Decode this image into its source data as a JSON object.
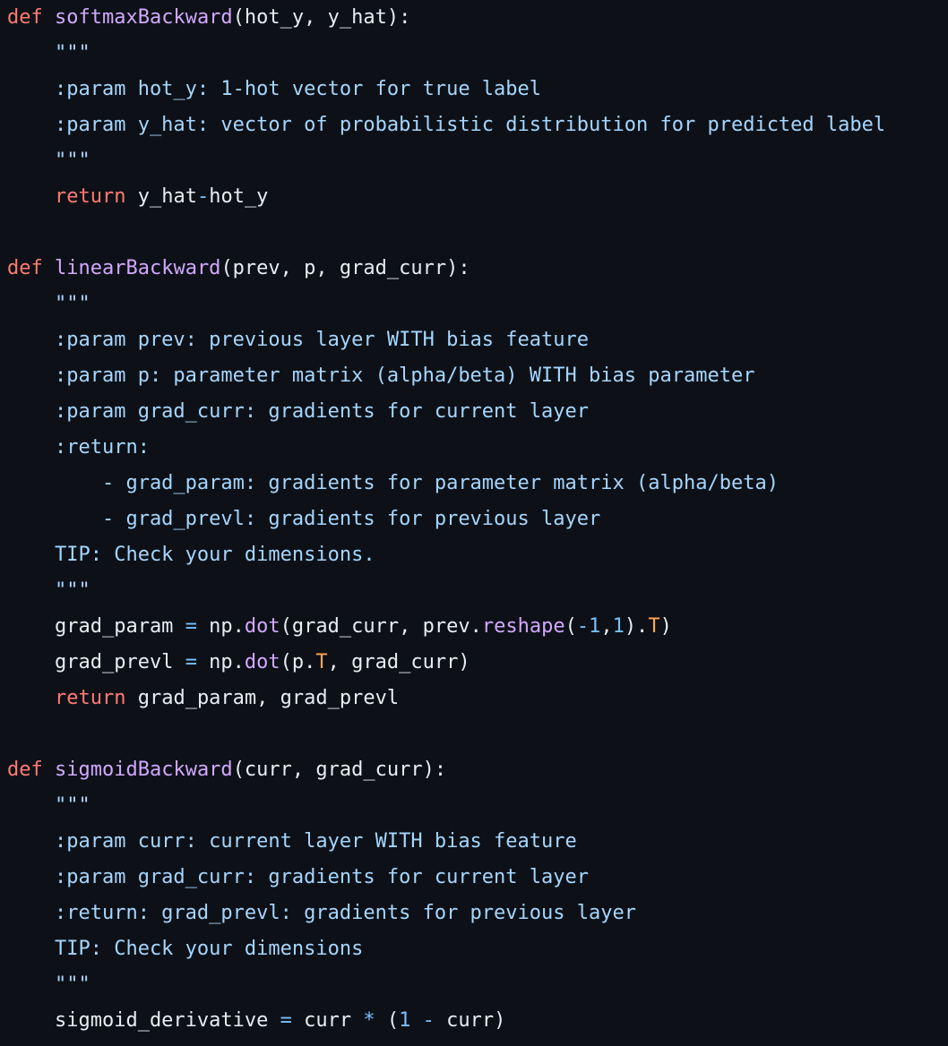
{
  "code_lines": [
    [
      {
        "t": "def",
        "c": "kw"
      },
      {
        "t": " ",
        "c": "plain"
      },
      {
        "t": "softmaxBackward",
        "c": "fn"
      },
      {
        "t": "(hot_y, y_hat):",
        "c": "plain"
      }
    ],
    [
      {
        "t": "    \"\"\"",
        "c": "doc"
      }
    ],
    [
      {
        "t": "    :param hot_y: 1-hot vector for true label",
        "c": "doc"
      }
    ],
    [
      {
        "t": "    :param y_hat: vector of probabilistic distribution for predicted label",
        "c": "doc"
      }
    ],
    [
      {
        "t": "    \"\"\"",
        "c": "doc"
      }
    ],
    [
      {
        "t": "    ",
        "c": "plain"
      },
      {
        "t": "return",
        "c": "kw"
      },
      {
        "t": " y_hat",
        "c": "plain"
      },
      {
        "t": "-",
        "c": "op"
      },
      {
        "t": "hot_y",
        "c": "plain"
      }
    ],
    [],
    [
      {
        "t": "def",
        "c": "kw"
      },
      {
        "t": " ",
        "c": "plain"
      },
      {
        "t": "linearBackward",
        "c": "fn"
      },
      {
        "t": "(prev, p, grad_curr):",
        "c": "plain"
      }
    ],
    [
      {
        "t": "    \"\"\"",
        "c": "doc"
      }
    ],
    [
      {
        "t": "    :param prev: previous layer WITH bias feature",
        "c": "doc"
      }
    ],
    [
      {
        "t": "    :param p: parameter matrix (alpha/beta) WITH bias parameter",
        "c": "doc"
      }
    ],
    [
      {
        "t": "    :param grad_curr: gradients for current layer",
        "c": "doc"
      }
    ],
    [
      {
        "t": "    :return:",
        "c": "doc"
      }
    ],
    [
      {
        "t": "        - grad_param: gradients for parameter matrix (alpha/beta)",
        "c": "doc"
      }
    ],
    [
      {
        "t": "        - grad_prevl: gradients for previous layer",
        "c": "doc"
      }
    ],
    [
      {
        "t": "    TIP: Check your dimensions.",
        "c": "doc"
      }
    ],
    [
      {
        "t": "    \"\"\"",
        "c": "doc"
      }
    ],
    [
      {
        "t": "    grad_param ",
        "c": "plain"
      },
      {
        "t": "=",
        "c": "op"
      },
      {
        "t": " np.",
        "c": "plain"
      },
      {
        "t": "dot",
        "c": "meth"
      },
      {
        "t": "(grad_curr, prev.",
        "c": "plain"
      },
      {
        "t": "reshape",
        "c": "meth"
      },
      {
        "t": "(",
        "c": "plain"
      },
      {
        "t": "-1",
        "c": "num"
      },
      {
        "t": ",",
        "c": "plain"
      },
      {
        "t": "1",
        "c": "num"
      },
      {
        "t": ").",
        "c": "plain"
      },
      {
        "t": "T",
        "c": "const"
      },
      {
        "t": ")",
        "c": "plain"
      }
    ],
    [
      {
        "t": "    grad_prevl ",
        "c": "plain"
      },
      {
        "t": "=",
        "c": "op"
      },
      {
        "t": " np.",
        "c": "plain"
      },
      {
        "t": "dot",
        "c": "meth"
      },
      {
        "t": "(p.",
        "c": "plain"
      },
      {
        "t": "T",
        "c": "const"
      },
      {
        "t": ", grad_curr)",
        "c": "plain"
      }
    ],
    [
      {
        "t": "    ",
        "c": "plain"
      },
      {
        "t": "return",
        "c": "kw"
      },
      {
        "t": " grad_param, grad_prevl",
        "c": "plain"
      }
    ],
    [],
    [
      {
        "t": "def",
        "c": "kw"
      },
      {
        "t": " ",
        "c": "plain"
      },
      {
        "t": "sigmoidBackward",
        "c": "fn"
      },
      {
        "t": "(curr, grad_curr):",
        "c": "plain"
      }
    ],
    [
      {
        "t": "    \"\"\"",
        "c": "doc"
      }
    ],
    [
      {
        "t": "    :param curr: current layer WITH bias feature",
        "c": "doc"
      }
    ],
    [
      {
        "t": "    :param grad_curr: gradients for current layer",
        "c": "doc"
      }
    ],
    [
      {
        "t": "    :return: grad_prevl: gradients for previous layer",
        "c": "doc"
      }
    ],
    [
      {
        "t": "    TIP: Check your dimensions",
        "c": "doc"
      }
    ],
    [
      {
        "t": "    \"\"\"",
        "c": "doc"
      }
    ],
    [
      {
        "t": "    sigmoid_derivative ",
        "c": "plain"
      },
      {
        "t": "=",
        "c": "op"
      },
      {
        "t": " curr ",
        "c": "plain"
      },
      {
        "t": "*",
        "c": "op"
      },
      {
        "t": " (",
        "c": "plain"
      },
      {
        "t": "1",
        "c": "num"
      },
      {
        "t": " ",
        "c": "plain"
      },
      {
        "t": "-",
        "c": "op"
      },
      {
        "t": " curr)",
        "c": "plain"
      }
    ]
  ],
  "colors": {
    "background": "#0d1117",
    "keyword": "#ff7b72",
    "function_name": "#d2a8ff",
    "docstring": "#a5d6ff",
    "operator": "#79c0ff",
    "number": "#79c0ff",
    "constant": "#ffa657",
    "text": "#e6edf3"
  }
}
